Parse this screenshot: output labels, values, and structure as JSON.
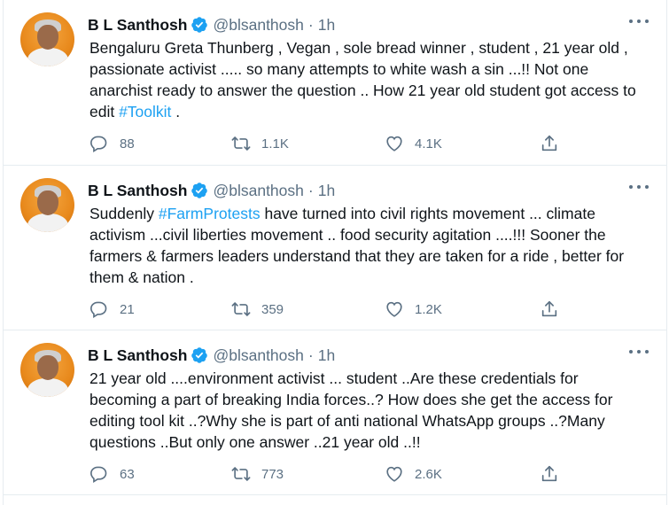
{
  "tweets": [
    {
      "author": {
        "name": "B L Santhosh",
        "handle": "@blsanthosh",
        "verified": true
      },
      "time": "1h",
      "text_parts": [
        {
          "text": "Bengaluru Greta Thunberg , Vegan , sole bread winner , student , 21 year old , passionate activist ..... so many attempts to white wash a sin ...!! Not one anarchist ready to answer the question .. How 21 year old student  got access to edit "
        },
        {
          "hashtag": "#Toolkit"
        },
        {
          "text": " ."
        }
      ],
      "replies": "88",
      "retweets": "1.1K",
      "likes": "4.1K"
    },
    {
      "author": {
        "name": "B L Santhosh",
        "handle": "@blsanthosh",
        "verified": true
      },
      "time": "1h",
      "text_parts": [
        {
          "text": "Suddenly "
        },
        {
          "hashtag": "#FarmProtests"
        },
        {
          "text": " have turned into civil rights movement ... climate activism ...civil liberties movement .. food security agitation ....!!! Sooner the farmers & farmers leaders understand that they are taken for a ride , better for them & nation ."
        }
      ],
      "replies": "21",
      "retweets": "359",
      "likes": "1.2K"
    },
    {
      "author": {
        "name": "B L Santhosh",
        "handle": "@blsanthosh",
        "verified": true
      },
      "time": "1h",
      "text_parts": [
        {
          "text": "21 year old ....environment activist ... student ..Are these credentials for becoming a part of breaking India forces..? How does she get the access for editing tool kit ..?Why she is part of anti national WhatsApp groups ..?Many questions ..But only one answer ..21 year old ..!!"
        }
      ],
      "replies": "63",
      "retweets": "773",
      "likes": "2.6K"
    }
  ],
  "colors": {
    "accent": "#1da1f2",
    "secondary_text": "#5b7083",
    "primary_text": "#0f1419",
    "divider": "#e6ecf0"
  },
  "icons": {
    "verified": "verified-badge-icon",
    "more": "more-dots-icon",
    "reply": "reply-icon",
    "retweet": "retweet-icon",
    "like": "heart-icon",
    "share": "share-icon"
  }
}
